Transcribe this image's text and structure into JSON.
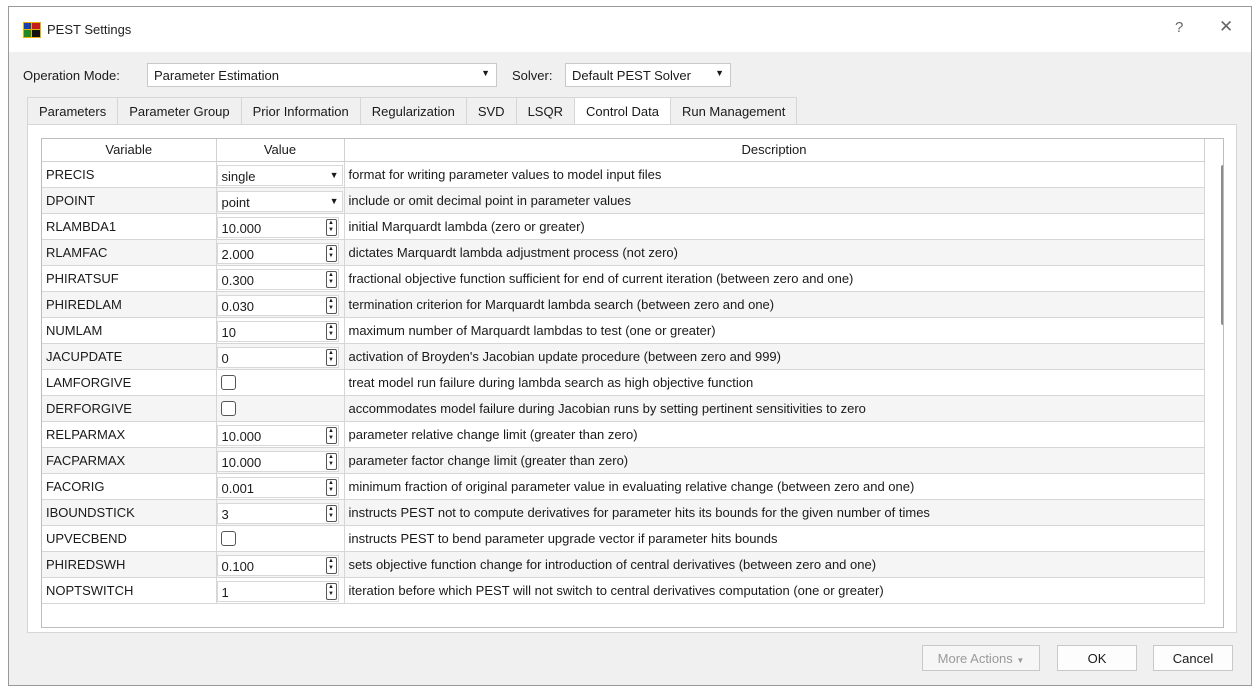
{
  "window": {
    "title": "PEST Settings",
    "help_glyph": "?",
    "close_glyph": "✕"
  },
  "toolbar": {
    "operation_label": "Operation Mode:",
    "operation_value": "Parameter Estimation",
    "solver_label": "Solver:",
    "solver_value": "Default PEST Solver"
  },
  "tabs": [
    {
      "label": "Parameters"
    },
    {
      "label": "Parameter Group"
    },
    {
      "label": "Prior Information"
    },
    {
      "label": "Regularization"
    },
    {
      "label": "SVD"
    },
    {
      "label": "LSQR"
    },
    {
      "label": "Control Data",
      "active": true
    },
    {
      "label": "Run Management"
    }
  ],
  "table": {
    "headers": [
      "Variable",
      "Value",
      "Description"
    ],
    "rows": [
      {
        "variable": "PRECIS",
        "type": "select",
        "value": "single",
        "description": "format for writing parameter values to model input files"
      },
      {
        "variable": "DPOINT",
        "type": "select",
        "value": "point",
        "description": "include or omit decimal point in parameter values"
      },
      {
        "variable": "RLAMBDA1",
        "type": "spin",
        "value": "10.000",
        "description": "initial Marquardt lambda (zero or greater)"
      },
      {
        "variable": "RLAMFAC",
        "type": "spin",
        "value": "2.000",
        "description": "dictates Marquardt lambda adjustment process (not zero)"
      },
      {
        "variable": "PHIRATSUF",
        "type": "spin",
        "value": "0.300",
        "description": "fractional objective function sufficient for end of current iteration (between zero and one)"
      },
      {
        "variable": "PHIREDLAM",
        "type": "spin",
        "value": "0.030",
        "description": "termination criterion for Marquardt lambda search (between zero and one)"
      },
      {
        "variable": "NUMLAM",
        "type": "spin",
        "value": "10",
        "description": "maximum number of Marquardt lambdas to test (one or greater)"
      },
      {
        "variable": "JACUPDATE",
        "type": "spin",
        "value": "0",
        "description": "activation of Broyden's Jacobian update procedure (between zero and 999)"
      },
      {
        "variable": "LAMFORGIVE",
        "type": "check",
        "value": "",
        "description": "treat model run failure during lambda search as high objective function"
      },
      {
        "variable": "DERFORGIVE",
        "type": "check",
        "value": "",
        "description": "accommodates model failure during Jacobian runs by setting pertinent sensitivities to zero"
      },
      {
        "variable": "RELPARMAX",
        "type": "spin",
        "value": "10.000",
        "description": "parameter relative change limit (greater than zero)"
      },
      {
        "variable": "FACPARMAX",
        "type": "spin",
        "value": "10.000",
        "description": "parameter factor change limit (greater than zero)"
      },
      {
        "variable": "FACORIG",
        "type": "spin",
        "value": "0.001",
        "description": "minimum fraction of original parameter value in evaluating relative change (between zero and one)"
      },
      {
        "variable": "IBOUNDSTICK",
        "type": "spin",
        "value": "3",
        "description": "instructs PEST not to compute derivatives for parameter hits its bounds for the given number of times"
      },
      {
        "variable": "UPVECBEND",
        "type": "check",
        "value": "",
        "description": "instructs PEST to bend parameter upgrade vector if parameter hits bounds"
      },
      {
        "variable": "PHIREDSWH",
        "type": "spin",
        "value": "0.100",
        "description": "sets objective function change for introduction of central derivatives (between zero and one)"
      },
      {
        "variable": "NOPTSWITCH",
        "type": "spin",
        "value": "1",
        "description": "iteration before which PEST will not switch to central derivatives computation (one or greater)"
      }
    ]
  },
  "footer": {
    "more_actions": "More Actions",
    "ok": "OK",
    "cancel": "Cancel"
  }
}
